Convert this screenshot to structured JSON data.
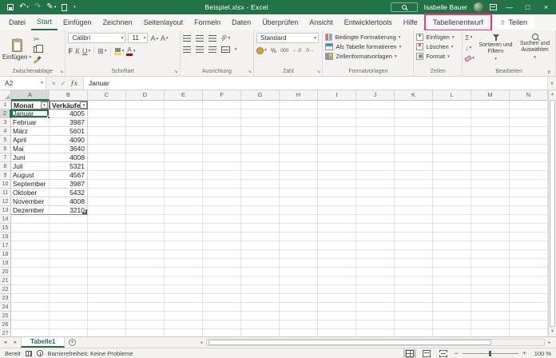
{
  "titlebar": {
    "title": "Beispiel.xlsx - Excel",
    "user": "Isabelle Bauer"
  },
  "tabs": {
    "items": [
      {
        "label": "Datei"
      },
      {
        "label": "Start",
        "active": true
      },
      {
        "label": "Einfügen"
      },
      {
        "label": "Zeichnen"
      },
      {
        "label": "Seitenlayout"
      },
      {
        "label": "Formeln"
      },
      {
        "label": "Daten"
      },
      {
        "label": "Überprüfen"
      },
      {
        "label": "Ansicht"
      },
      {
        "label": "Entwicklertools"
      },
      {
        "label": "Hilfe"
      },
      {
        "label": "Tabellenentwurf",
        "highlighted": true
      }
    ],
    "share_label": "Teilen"
  },
  "ribbon": {
    "clipboard": {
      "group_label": "Zwischenablage",
      "paste_label": "Einfügen"
    },
    "font": {
      "group_label": "Schriftart",
      "font_name": "Calibri",
      "font_size": "11",
      "bold": "F",
      "italic": "K",
      "underline": "U"
    },
    "alignment": {
      "group_label": "Ausrichtung",
      "orientation_text": "ab"
    },
    "number": {
      "group_label": "Zahl",
      "format": "Standard",
      "percent": "%",
      "thousands": "000",
      "increase_decimal": "←.0",
      "decrease_decimal": ".0→"
    },
    "styles": {
      "group_label": "Formatvorlagen",
      "items": [
        "Bedingte Formatierung",
        "Als Tabelle formatieren",
        "Zellenformatvorlagen"
      ]
    },
    "cells": {
      "group_label": "Zellen",
      "items": [
        "Einfügen",
        "Löschen",
        "Format"
      ]
    },
    "editing": {
      "group_label": "Bearbeiten",
      "autosum": "Σ",
      "sort_label": "Sortieren und Filtern",
      "find_label": "Suchen und Auswählen"
    }
  },
  "formula_bar": {
    "name_box": "A2",
    "fx": "ƒx",
    "value": "Januar"
  },
  "sheet": {
    "columns": [
      "A",
      "B",
      "C",
      "D",
      "E",
      "F",
      "G",
      "H",
      "I",
      "J",
      "K",
      "L",
      "M",
      "N"
    ],
    "row_count": 27,
    "selected_cell": "A2",
    "table": {
      "headers": [
        "Monat",
        "Verkäufe"
      ],
      "rows": [
        [
          "Januar",
          4005
        ],
        [
          "Februar",
          3987
        ],
        [
          "März",
          5601
        ],
        [
          "April",
          4090
        ],
        [
          "Mai",
          3640
        ],
        [
          "Juni",
          4008
        ],
        [
          "Juli",
          5321
        ],
        [
          "August",
          4567
        ],
        [
          "September",
          3987
        ],
        [
          "Oktober",
          5432
        ],
        [
          "November",
          4008
        ],
        [
          "Dezember",
          3210
        ]
      ]
    }
  },
  "sheet_tabs": {
    "active": "Tabelle1"
  },
  "status_bar": {
    "ready": "Bereit",
    "accessibility": "Barrierefreiheit: Keine Probleme",
    "zoom": "100 %"
  },
  "colors": {
    "excel_green": "#217346",
    "annotation_pink": "#e8397f",
    "selection_green": "#217346"
  }
}
